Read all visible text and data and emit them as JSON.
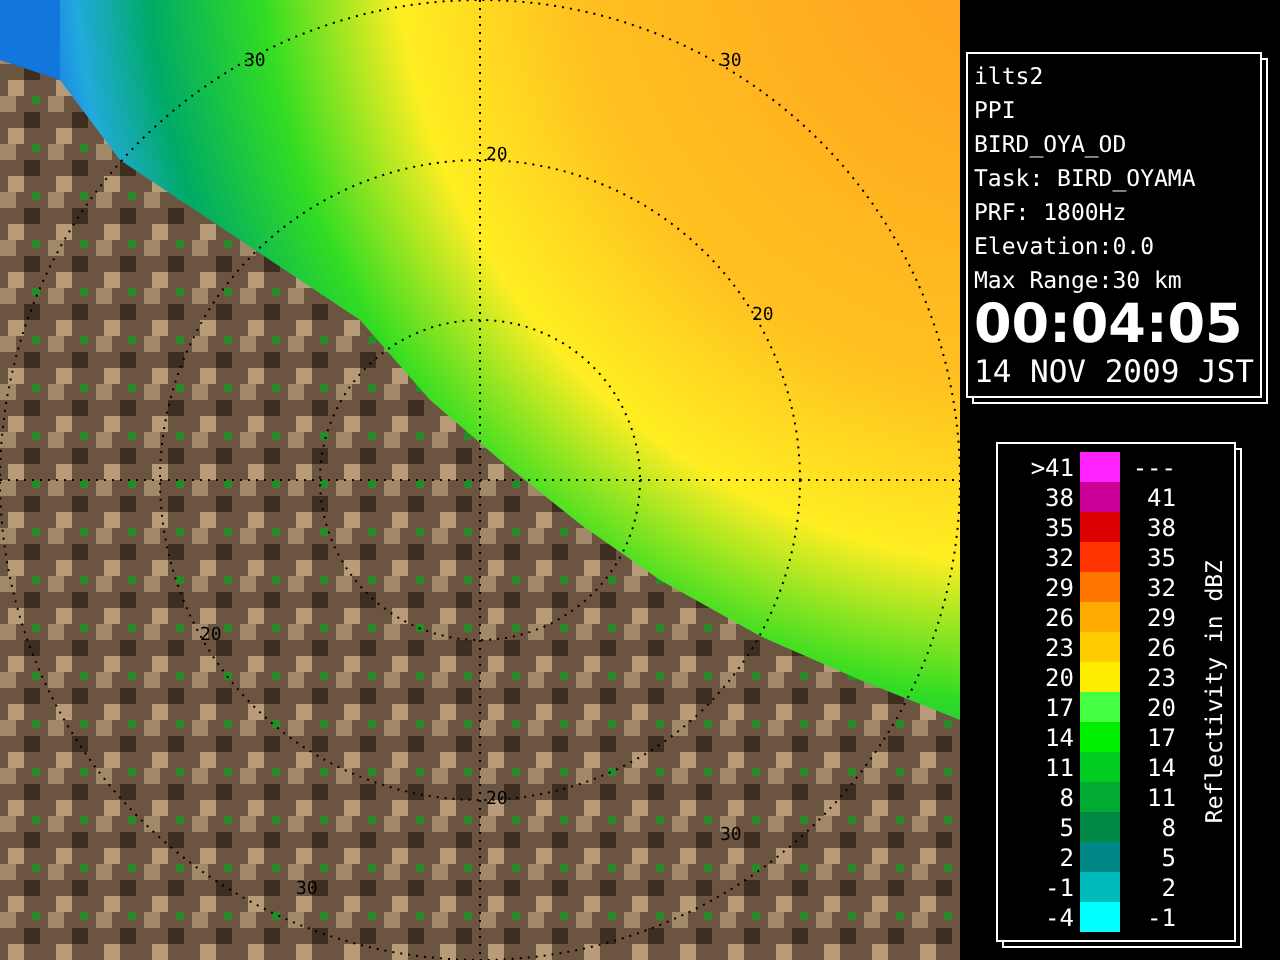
{
  "radar_ppi": {
    "ring_labels": [
      {
        "text": "30"
      },
      {
        "text": "30"
      },
      {
        "text": "20"
      },
      {
        "text": "20"
      },
      {
        "text": "20"
      },
      {
        "text": "20"
      },
      {
        "text": "30"
      },
      {
        "text": "30"
      }
    ]
  },
  "info_panel": {
    "lines": [
      "ilts2",
      "PPI",
      "BIRD_OYA_OD",
      "Task: BIRD_OYAMA",
      "PRF: 1800Hz",
      "Elevation:0.0",
      "Max Range:30 km"
    ],
    "time": "00:04:05",
    "date": "14 NOV 2009 JST"
  },
  "legend": {
    "title": "Reflectivity in dBZ",
    "rows": [
      {
        "low": ">41",
        "high": "---",
        "color": "#ff22ff"
      },
      {
        "low": "38",
        "high": "41",
        "color": "#cc0099"
      },
      {
        "low": "35",
        "high": "38",
        "color": "#dd0000"
      },
      {
        "low": "32",
        "high": "35",
        "color": "#ff3300"
      },
      {
        "low": "29",
        "high": "32",
        "color": "#ff7700"
      },
      {
        "low": "26",
        "high": "29",
        "color": "#ffaa00"
      },
      {
        "low": "23",
        "high": "26",
        "color": "#ffcc00"
      },
      {
        "low": "20",
        "high": "23",
        "color": "#ffee00"
      },
      {
        "low": "17",
        "high": "20",
        "color": "#44ff44"
      },
      {
        "low": "14",
        "high": "17",
        "color": "#00ee00"
      },
      {
        "low": "11",
        "high": "14",
        "color": "#00cc22"
      },
      {
        "low": "8",
        "high": "11",
        "color": "#00aa33"
      },
      {
        "low": "5",
        "high": "8",
        "color": "#008844"
      },
      {
        "low": "2",
        "high": "5",
        "color": "#008888"
      },
      {
        "low": "-1",
        "high": "2",
        "color": "#00bbbb"
      },
      {
        "low": "-4",
        "high": "-1",
        "color": "#00ffff"
      }
    ]
  }
}
